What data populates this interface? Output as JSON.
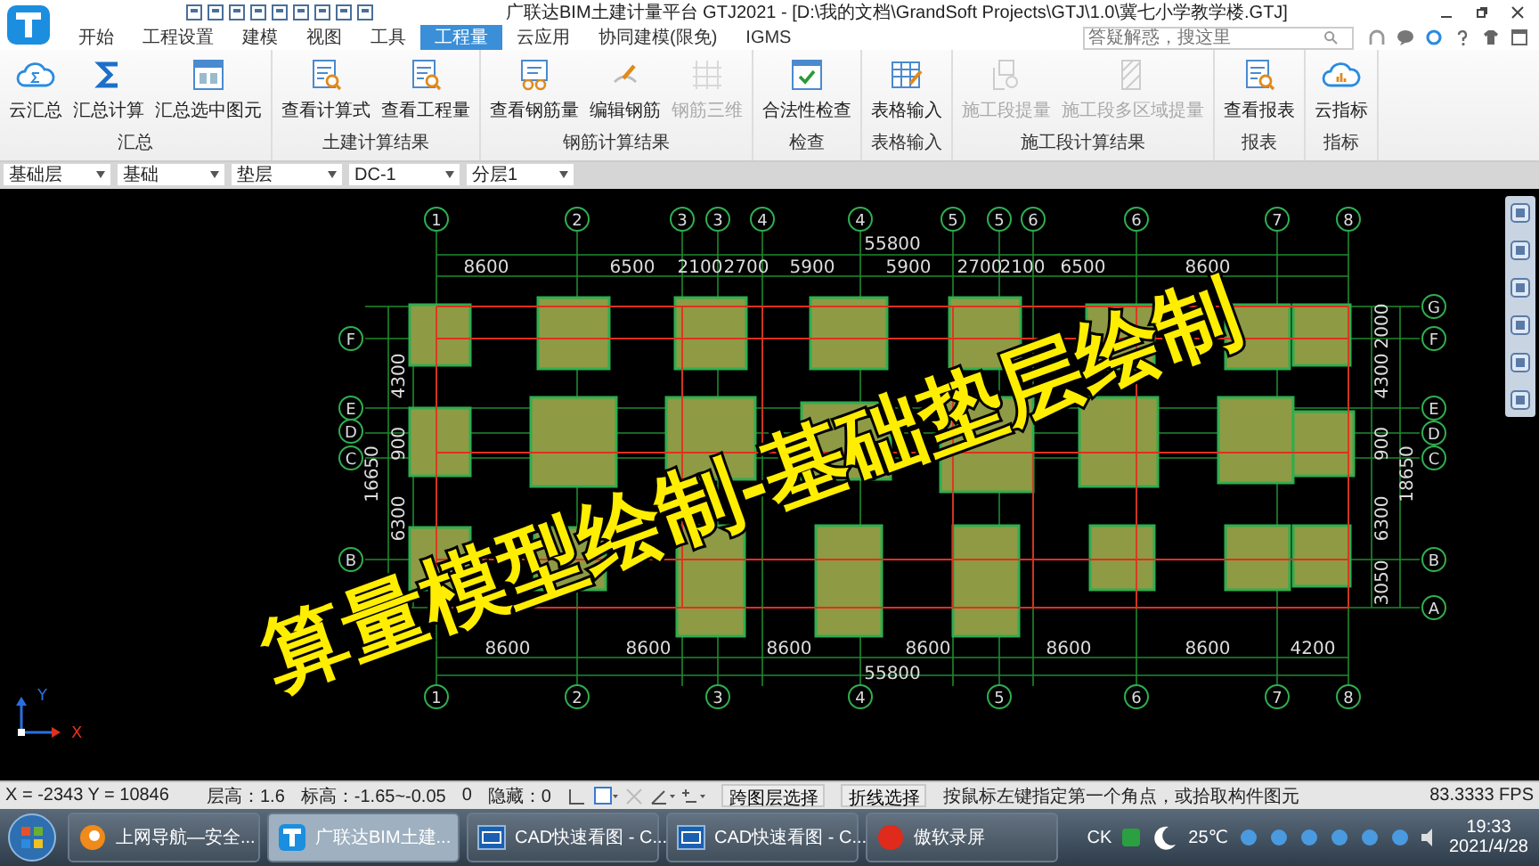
{
  "window": {
    "title": "广联达BIM土建计量平台 GTJ2021 - [D:\\我的文档\\GrandSoft Projects\\GTJ\\1.0\\冀七小学教学楼.GTJ]"
  },
  "search": {
    "placeholder": "答疑解惑，搜这里"
  },
  "tabs": [
    {
      "label": "开始",
      "selected": false
    },
    {
      "label": "工程设置",
      "selected": false
    },
    {
      "label": "建模",
      "selected": false
    },
    {
      "label": "视图",
      "selected": false
    },
    {
      "label": "工具",
      "selected": false
    },
    {
      "label": "工程量",
      "selected": true
    },
    {
      "label": "云应用",
      "selected": false
    },
    {
      "label": "协同建模(限免)",
      "selected": false
    },
    {
      "label": "IGMS",
      "selected": false
    }
  ],
  "ribbon_groups": [
    {
      "label": "汇总",
      "buttons": [
        {
          "label": "云汇总",
          "disabled": false
        },
        {
          "label": "汇总计算",
          "disabled": false
        },
        {
          "label": "汇总选中图元",
          "disabled": false
        }
      ]
    },
    {
      "label": "土建计算结果",
      "buttons": [
        {
          "label": "查看计算式",
          "disabled": false
        },
        {
          "label": "查看工程量",
          "disabled": false
        }
      ]
    },
    {
      "label": "钢筋计算结果",
      "buttons": [
        {
          "label": "查看钢筋量",
          "disabled": false
        },
        {
          "label": "编辑钢筋",
          "disabled": false
        },
        {
          "label": "钢筋三维",
          "disabled": true
        }
      ]
    },
    {
      "label": "检查",
      "buttons": [
        {
          "label": "合法性检查",
          "disabled": false
        }
      ]
    },
    {
      "label": "表格输入",
      "buttons": [
        {
          "label": "表格输入",
          "disabled": false
        }
      ]
    },
    {
      "label": "施工段计算结果",
      "buttons": [
        {
          "label": "施工段提量",
          "disabled": true
        },
        {
          "label": "施工段多区域提量",
          "disabled": true
        }
      ]
    },
    {
      "label": "报表",
      "buttons": [
        {
          "label": "查看报表",
          "disabled": false
        }
      ]
    },
    {
      "label": "指标",
      "buttons": [
        {
          "label": "云指标",
          "disabled": false
        }
      ]
    }
  ],
  "selectors": [
    "基础层",
    "基础",
    "垫层",
    "DC-1",
    "分层1"
  ],
  "plan": {
    "top_axes": [
      "1",
      "2",
      "3",
      "3",
      "4",
      "4",
      "5",
      "5",
      "6",
      "6",
      "7",
      "8"
    ],
    "top_total": "55800",
    "top_spans": [
      "8600",
      "6500",
      "2100",
      "2700",
      "5900",
      "5900",
      "2700",
      "2100",
      "6500",
      "8600"
    ],
    "left_axes": [
      "F",
      "E",
      "D",
      "C",
      "B"
    ],
    "right_axes": [
      "G",
      "F",
      "E",
      "D",
      "C",
      "B",
      "A"
    ],
    "left_dims": [
      "4300",
      "900",
      "16650",
      "6300"
    ],
    "right_dims": [
      "2000",
      "4300",
      "900",
      "18650",
      "6300",
      "3050"
    ],
    "bottom_spans": [
      "8600",
      "8600",
      "8600",
      "8600",
      "8600",
      "8600",
      "4200"
    ],
    "bottom_total": "55800",
    "bottom_axes": [
      "1",
      "2",
      "3",
      "4",
      "5",
      "6",
      "7",
      "8"
    ]
  },
  "axis_indicator": {
    "y_label": "Y",
    "x_label": "X"
  },
  "banner": "算量模型绘制-基础垫层绘制",
  "status_bar": {
    "coords": "X = -2343 Y = 10846",
    "floor_height": "层高：1.6",
    "elevation": "标高：-1.65~-0.05",
    "count": "0",
    "hidden": "隐藏：0",
    "buttons": [
      "跨图层选择",
      "折线选择"
    ],
    "hint": "按鼠标左键指定第一个角点，或拾取构件图元",
    "fps": "83.3333 FPS"
  },
  "taskbar": {
    "items": [
      {
        "label": "上网导航—安全...",
        "selected": false
      },
      {
        "label": "广联达BIM土建...",
        "selected": true
      },
      {
        "label": "CAD快速看图 - C...",
        "selected": false
      },
      {
        "label": "CAD快速看图 - C...",
        "selected": false
      },
      {
        "label": "傲软录屏",
        "selected": false
      }
    ],
    "tray": {
      "ime": "CK",
      "temperature": "25℃",
      "time": "19:33",
      "date": "2021/4/28"
    }
  }
}
